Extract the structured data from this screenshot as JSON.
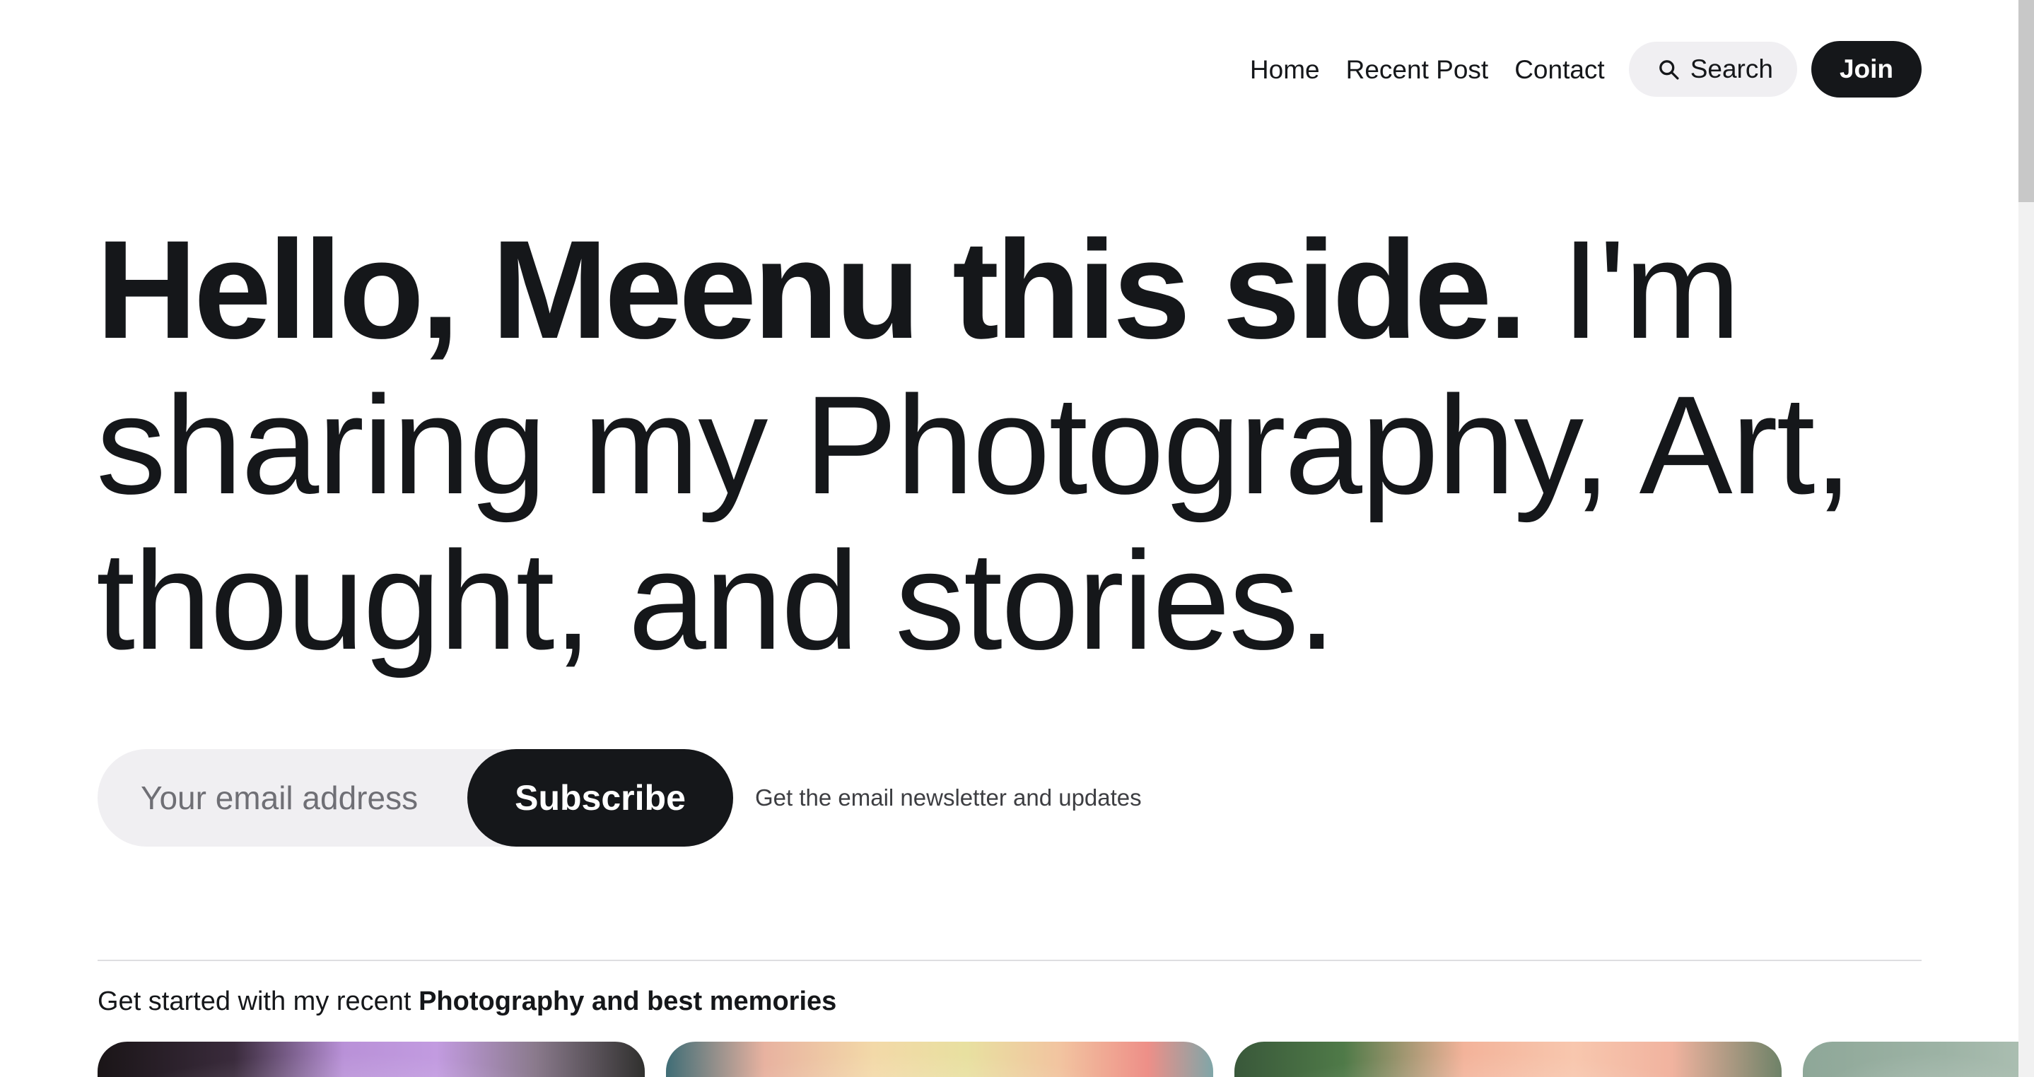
{
  "nav": {
    "links": [
      "Home",
      "Recent Post",
      "Contact"
    ],
    "search_label": "Search",
    "join_label": "Join"
  },
  "hero": {
    "bold": "Hello, Meenu this side.",
    "rest": " I'm sharing my Photography, Art, thought, and stories."
  },
  "subscribe": {
    "placeholder": "Your email address",
    "button_label": "Subscribe",
    "note": "Get the email newsletter and updates"
  },
  "section": {
    "intro": "Get started with my recent ",
    "intro_bold": "Photography and best memories"
  },
  "colors": {
    "text": "#15171a",
    "pill_bg": "#f0eff2",
    "button_bg": "#15171a",
    "divider": "#dedee1"
  }
}
